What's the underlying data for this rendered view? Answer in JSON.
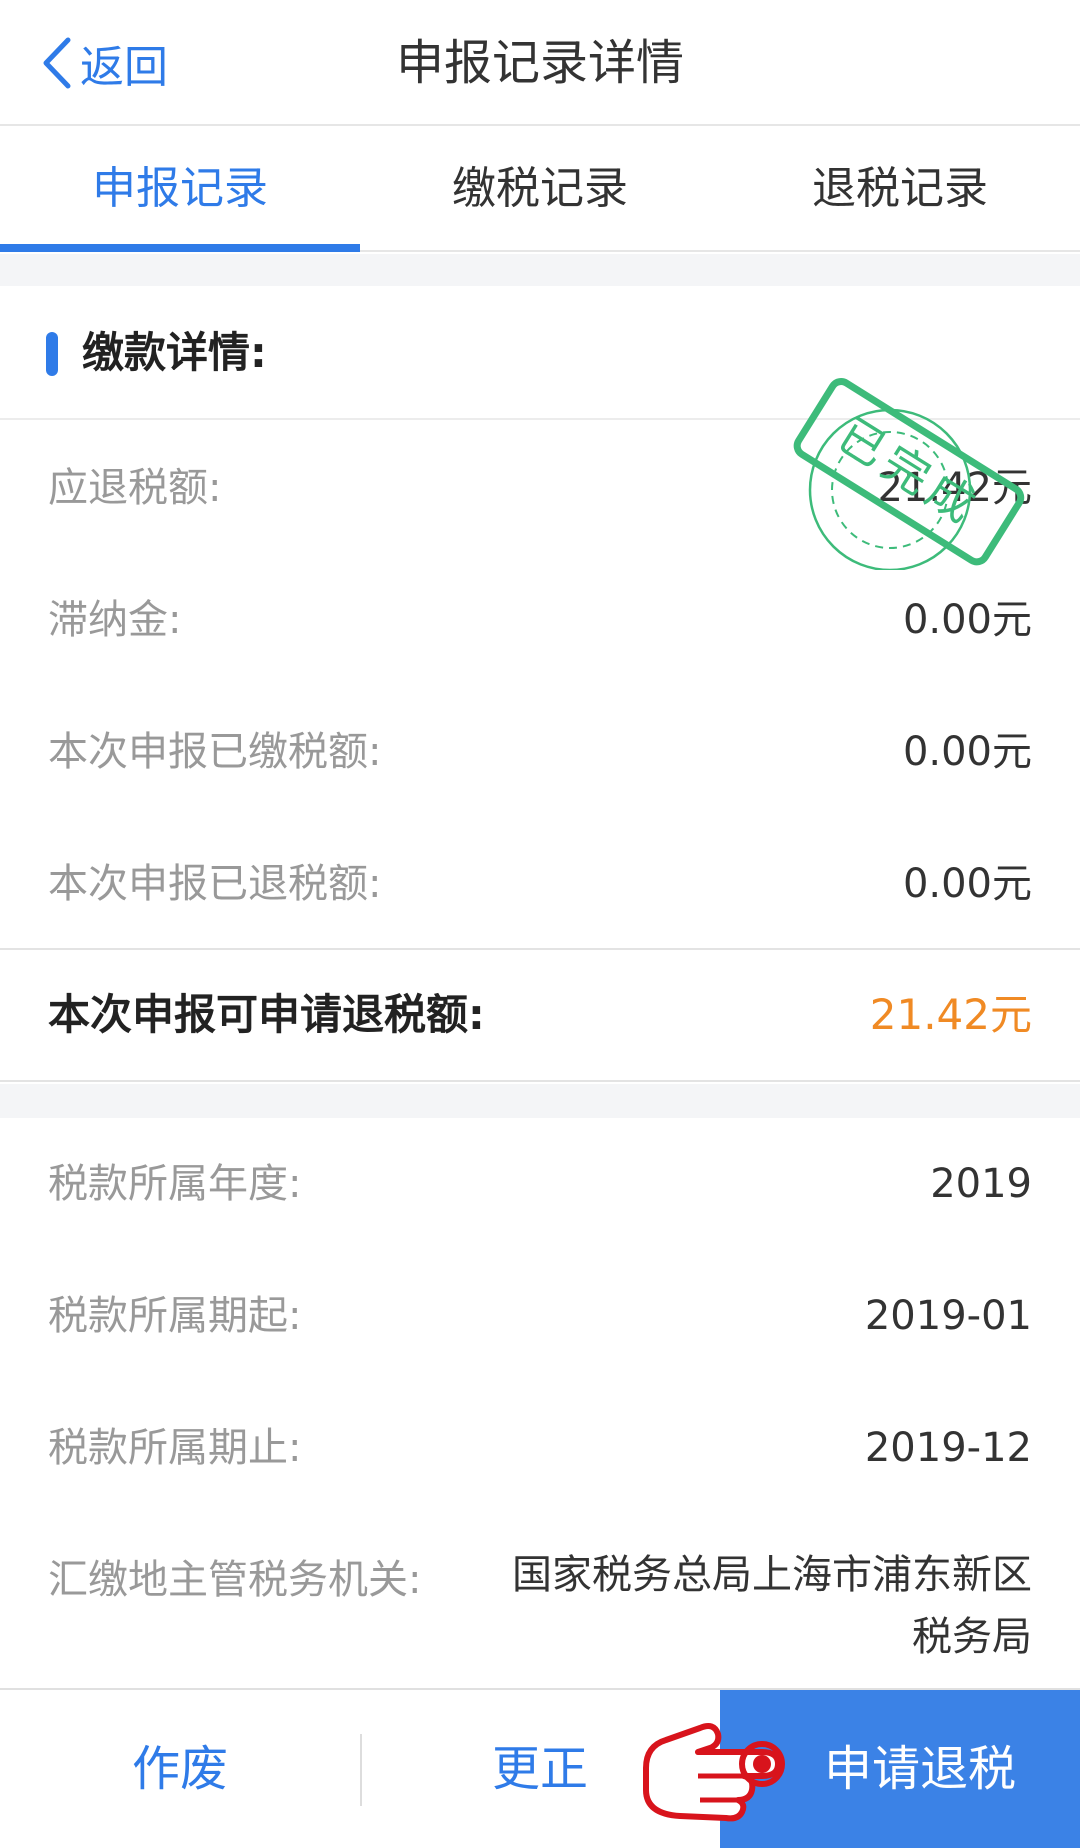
{
  "header": {
    "back_label": "返回",
    "title": "申报记录详情"
  },
  "tabs": [
    {
      "label": "申报记录",
      "active": true
    },
    {
      "label": "缴税记录",
      "active": false
    },
    {
      "label": "退税记录",
      "active": false
    }
  ],
  "section": {
    "title": "缴款详情:",
    "stamp_text": "已完成"
  },
  "details": [
    {
      "label": "应退税额:",
      "value": "21.42元"
    },
    {
      "label": "滞纳金:",
      "value": "0.00元"
    },
    {
      "label": "本次申报已缴税额:",
      "value": "0.00元"
    },
    {
      "label": "本次申报已退税额:",
      "value": "0.00元"
    }
  ],
  "highlight": {
    "label": "本次申报可申请退税额:",
    "value": "21.42元"
  },
  "tax_info": [
    {
      "label": "税款所属年度:",
      "value": "2019"
    },
    {
      "label": "税款所属期起:",
      "value": "2019-01"
    },
    {
      "label": "税款所属期止:",
      "value": "2019-12"
    },
    {
      "label": "汇缴地主管税务机关:",
      "value": "国家税务总局上海市浦东新区税务局"
    }
  ],
  "bottom_bar": {
    "void_label": "作废",
    "fix_label": "更正",
    "refund_label": "申请退税"
  },
  "colors": {
    "accent": "#2f7be8",
    "highlight": "#f08a24",
    "stamp": "#3dbb7a"
  }
}
